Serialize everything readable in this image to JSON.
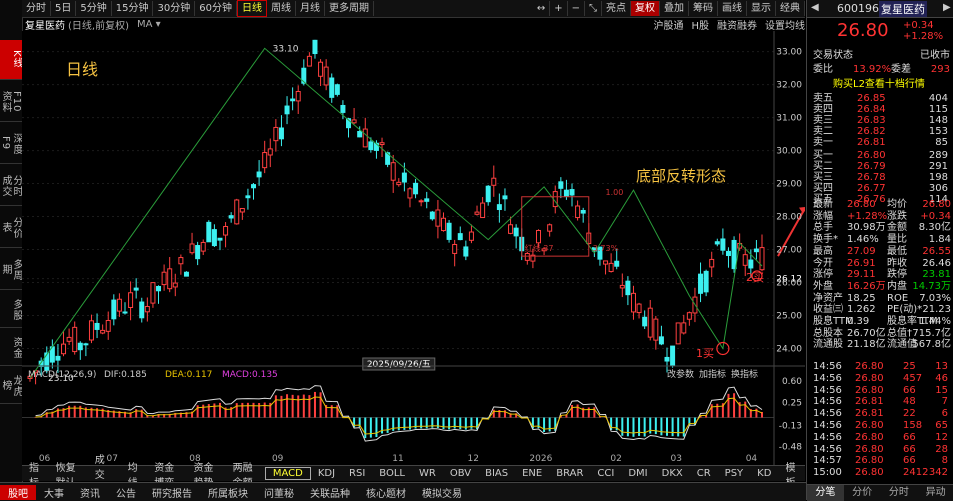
{
  "side_tabs": [
    "K线",
    "F10资料",
    "深度F9",
    "分时成交",
    "分价表",
    "多周期",
    "多股",
    "资金",
    "龙虎榜"
  ],
  "toolbar": {
    "items": [
      "分时",
      "5日",
      "5分钟",
      "15分钟",
      "30分钟",
      "60分钟",
      "日线",
      "周线",
      "月线",
      "更多周期"
    ],
    "active": "日线",
    "right": [
      "亮点",
      "复权",
      "叠加",
      "筹码",
      "画线",
      "显示",
      "经典"
    ],
    "icons": [
      "↔",
      "+",
      "−",
      "⤡"
    ]
  },
  "title": {
    "name": "复星医药",
    "mode": "(日线,前复权)",
    "ma": "MA ▾",
    "right": [
      "沪股通",
      "H股",
      "融资融券",
      "设置均线"
    ]
  },
  "chart_label": "日线",
  "annotation": "底部反转形态",
  "marks": {
    "buy1": "1买",
    "buy2": "2买",
    "high": "33.10",
    "low": "23.10",
    "date": "2025/09/26/五",
    "pct1": "3.73%",
    "box1": "红线 37",
    "top2": "1.00"
  },
  "chart_data": {
    "type": "candlestick",
    "price_axis": [
      "33.00",
      "32.00",
      "31.00",
      "30.00",
      "29.00",
      "28.00",
      "27.00",
      "26.12",
      "26.00",
      "25.00",
      "24.00"
    ],
    "price_range": [
      23.5,
      33.2
    ],
    "x_ticks": [
      "06",
      "07",
      "08",
      "09",
      "11",
      "12",
      "2026",
      "02",
      "03",
      "04"
    ],
    "highlight_price": "26.12",
    "close_series": [
      23.1,
      23.6,
      24.0,
      24.3,
      24.1,
      24.6,
      24.9,
      25.2,
      25.5,
      25.3,
      25.8,
      26.2,
      26.5,
      27.1,
      27.6,
      27.3,
      28.1,
      28.7,
      29.3,
      30.1,
      31.2,
      32.0,
      33.1,
      32.2,
      31.6,
      31.0,
      30.5,
      30.0,
      29.6,
      29.0,
      28.6,
      28.2,
      27.7,
      27.3,
      27.1,
      28.2,
      29.1,
      28.3,
      27.4,
      27.0,
      27.3,
      28.6,
      28.9,
      28.0,
      27.1,
      26.5,
      26.1,
      25.4,
      25.0,
      24.3,
      23.9,
      24.8,
      25.7,
      26.4,
      27.2,
      26.8,
      26.6,
      26.8
    ],
    "macd": {
      "label": "MACD(12,26,9)",
      "dif": "DIF:0.185",
      "dea": "DEA:0.117",
      "macd": "MACD:0.135",
      "axis": [
        "0.60",
        "0.25",
        "-0.13",
        "-0.48"
      ]
    }
  },
  "macd_buttons": [
    "改参数",
    "加指标",
    "换指标"
  ],
  "bottom_tabs": [
    "指标",
    "恢复默认",
    "成交量",
    "均线",
    "资金博弈",
    "资金趋势",
    "两融余额",
    "MACD",
    "KDJ",
    "RSI",
    "BOLL",
    "WR",
    "OBV",
    "BIAS",
    "ENE",
    "BRAR",
    "CCI",
    "DMI",
    "DKX",
    "CR",
    "PSY",
    "KD",
    "模板"
  ],
  "bottom_active": "MACD",
  "bottom2": [
    "股吧",
    "大事",
    "资讯",
    "公告",
    "研究报告",
    "所属板块",
    "问董秘",
    "关联品种",
    "核心题材",
    "模拟交易"
  ],
  "quote": {
    "code": "600196",
    "name": "复星医药",
    "price": "26.80",
    "change": "+0.34",
    "pct": "+1.28%",
    "status_label": "交易状态",
    "status": "已收市",
    "wb_label": "委比",
    "wb": "13.92%",
    "wc_label": "委差",
    "wc": "293",
    "l2": "购买L2查看十档行情",
    "asks": [
      [
        "卖五",
        "26.85",
        "404"
      ],
      [
        "卖四",
        "26.84",
        "115"
      ],
      [
        "卖三",
        "26.83",
        "148"
      ],
      [
        "卖二",
        "26.82",
        "153"
      ],
      [
        "卖一",
        "26.81",
        "85"
      ]
    ],
    "bids": [
      [
        "买一",
        "26.80",
        "289"
      ],
      [
        "买二",
        "26.79",
        "291"
      ],
      [
        "买三",
        "26.78",
        "198"
      ],
      [
        "买四",
        "26.77",
        "306"
      ],
      [
        "买五",
        "26.76",
        "114"
      ]
    ],
    "stats": [
      [
        "最新",
        "26.80",
        "均价",
        "26.80"
      ],
      [
        "涨幅",
        "+1.28%",
        "涨跌",
        "+0.34"
      ],
      [
        "总手",
        "30.98万",
        "金额",
        "8.30亿"
      ],
      [
        "换手*",
        "1.46%",
        "量比",
        "1.84"
      ],
      [
        "最高",
        "27.09",
        "最低",
        "26.55"
      ],
      [
        "今开",
        "26.91",
        "昨收",
        "26.46"
      ],
      [
        "涨停",
        "29.11",
        "跌停",
        "23.81"
      ],
      [
        "外盘",
        "16.26万",
        "内盘",
        "14.73万"
      ],
      [
        "净资产",
        "18.25",
        "ROE",
        "7.03%"
      ],
      [
        "收益㈢",
        "1.262",
        "PE(动)*",
        "21.23"
      ],
      [
        "股息TTM",
        "0.39",
        "股息率TTM",
        "1.44%"
      ],
      [
        "总股本",
        "26.70亿",
        "总值†",
        "715.7亿"
      ],
      [
        "流通股",
        "21.18亿",
        "流通值",
        "567.8亿"
      ]
    ],
    "ticks": [
      [
        "14:56",
        "26.80",
        "25",
        "13"
      ],
      [
        "14:56",
        "26.80",
        "457",
        "46"
      ],
      [
        "14:56",
        "26.80",
        "66",
        "15"
      ],
      [
        "14:56",
        "26.81",
        "48",
        "7"
      ],
      [
        "14:56",
        "26.81",
        "22",
        "6"
      ],
      [
        "14:56",
        "26.80",
        "158",
        "65"
      ],
      [
        "14:56",
        "26.80",
        "66",
        "12"
      ],
      [
        "14:56",
        "26.80",
        "66",
        "28"
      ],
      [
        "14:57",
        "26.80",
        "66",
        "8"
      ],
      [
        "15:00",
        "26.80",
        "2412",
        "342"
      ]
    ],
    "tabs": [
      "分笔",
      "分价",
      "分时",
      "异动"
    ]
  }
}
